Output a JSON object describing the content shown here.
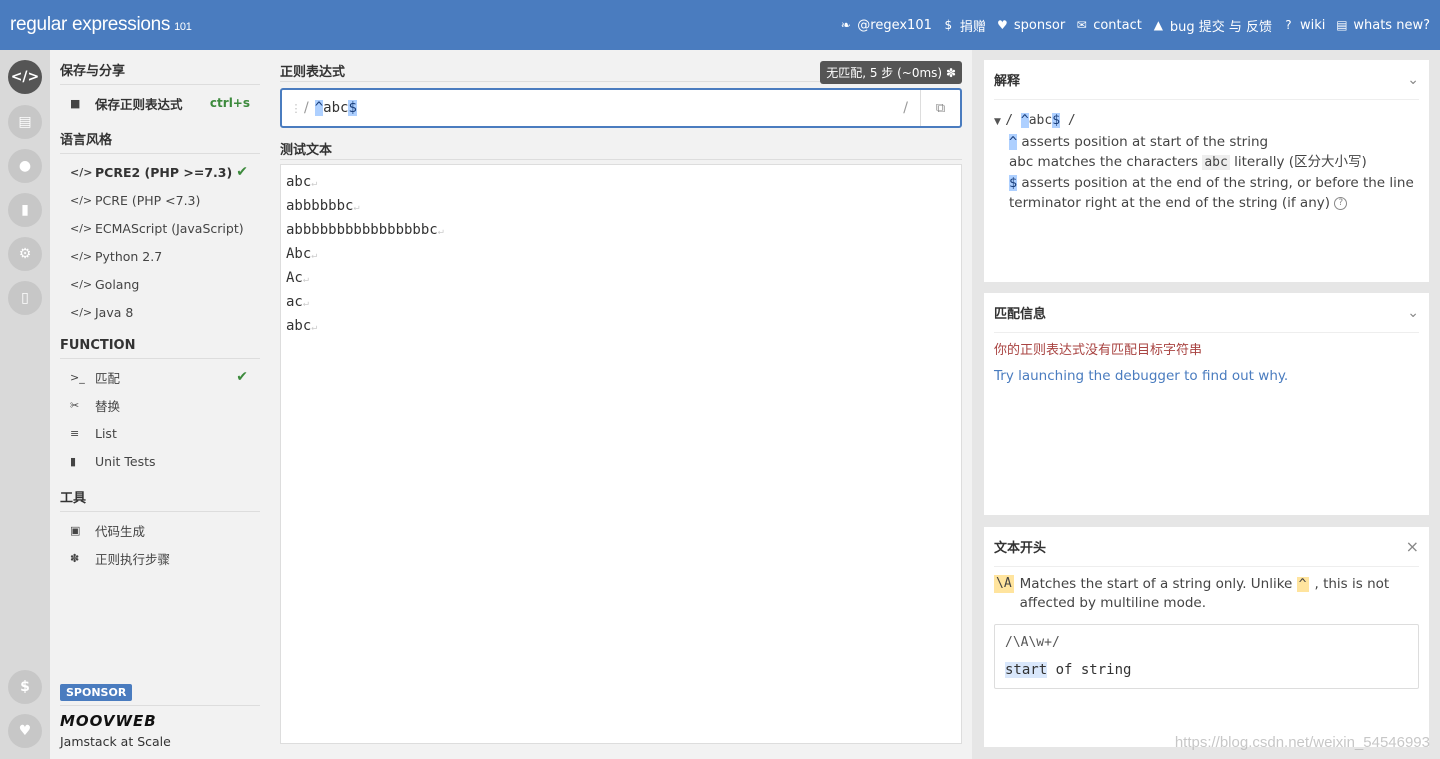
{
  "header": {
    "logo": "regular expressions",
    "logo_sub": "101",
    "nav": [
      {
        "icon": "twitter-icon",
        "glyph": "❧",
        "label": "@regex101"
      },
      {
        "icon": "dollar-icon",
        "glyph": "$",
        "label": "捐赠"
      },
      {
        "icon": "heart-icon",
        "glyph": "♥",
        "label": "sponsor"
      },
      {
        "icon": "mail-icon",
        "glyph": "✉",
        "label": "contact"
      },
      {
        "icon": "warning-icon",
        "glyph": "▲",
        "label": "bug 提交 与 反馈"
      },
      {
        "icon": "wiki-icon",
        "glyph": "?",
        "label": "wiki"
      },
      {
        "icon": "document-icon",
        "glyph": "▤",
        "label": "whats new?"
      }
    ]
  },
  "sidebar": {
    "save_section": "保存与分享",
    "save_label": "保存正则表达式",
    "save_shortcut": "ctrl+s",
    "flavor_section": "语言风格",
    "flavors": [
      "PCRE2 (PHP >=7.3)",
      "PCRE (PHP <7.3)",
      "ECMAScript (JavaScript)",
      "Python 2.7",
      "Golang",
      "Java 8"
    ],
    "function_section": "FUNCTION",
    "functions": [
      "匹配",
      "替换",
      "List",
      "Unit Tests"
    ],
    "tools_section": "工具",
    "tools": [
      "代码生成",
      "正则执行步骤"
    ],
    "sponsor_badge": "SPONSOR",
    "sponsor_brand": "MOOVWEB",
    "sponsor_tagline": "Jamstack at Scale"
  },
  "main": {
    "regex_label": "正则表达式",
    "match_status": "无匹配, 5 步 (~0ms)",
    "regex_delim": "/",
    "regex_parts": {
      "start": "^",
      "middle": "abc",
      "end": "$"
    },
    "test_label": "测试文本",
    "test_lines": [
      "abc",
      "abbbbbbc",
      "abbbbbbbbbbbbbbbbc",
      "Abc",
      "Ac",
      "ac",
      "abc"
    ]
  },
  "explanation": {
    "title": "解释",
    "tree_line": "/ ^abc$ /",
    "items": [
      {
        "token": "^",
        "text": " asserts position at start of the string"
      },
      {
        "token": "abc",
        "text": "abc matches the characters ",
        "code": "abc",
        "after": " literally (区分大小写)"
      },
      {
        "token": "$",
        "text": " asserts position at the end of the string, or before the line terminator right at the end of the string (if any)"
      }
    ]
  },
  "match_info": {
    "title": "匹配信息",
    "error": "你的正则表达式没有匹配目标字符串",
    "debug_link": "Try launching the debugger to find out why."
  },
  "quick_ref": {
    "title": "文本开头",
    "token": "\\A",
    "desc_before": "Matches the start of a string only. Unlike ",
    "desc_token": "^",
    "desc_after": ", this is not affected by multiline mode.",
    "example_pattern": "/\\A\\w+/",
    "example_match": "start",
    "example_rest": " of string"
  },
  "watermark": "https://blog.csdn.net/weixin_54546993"
}
